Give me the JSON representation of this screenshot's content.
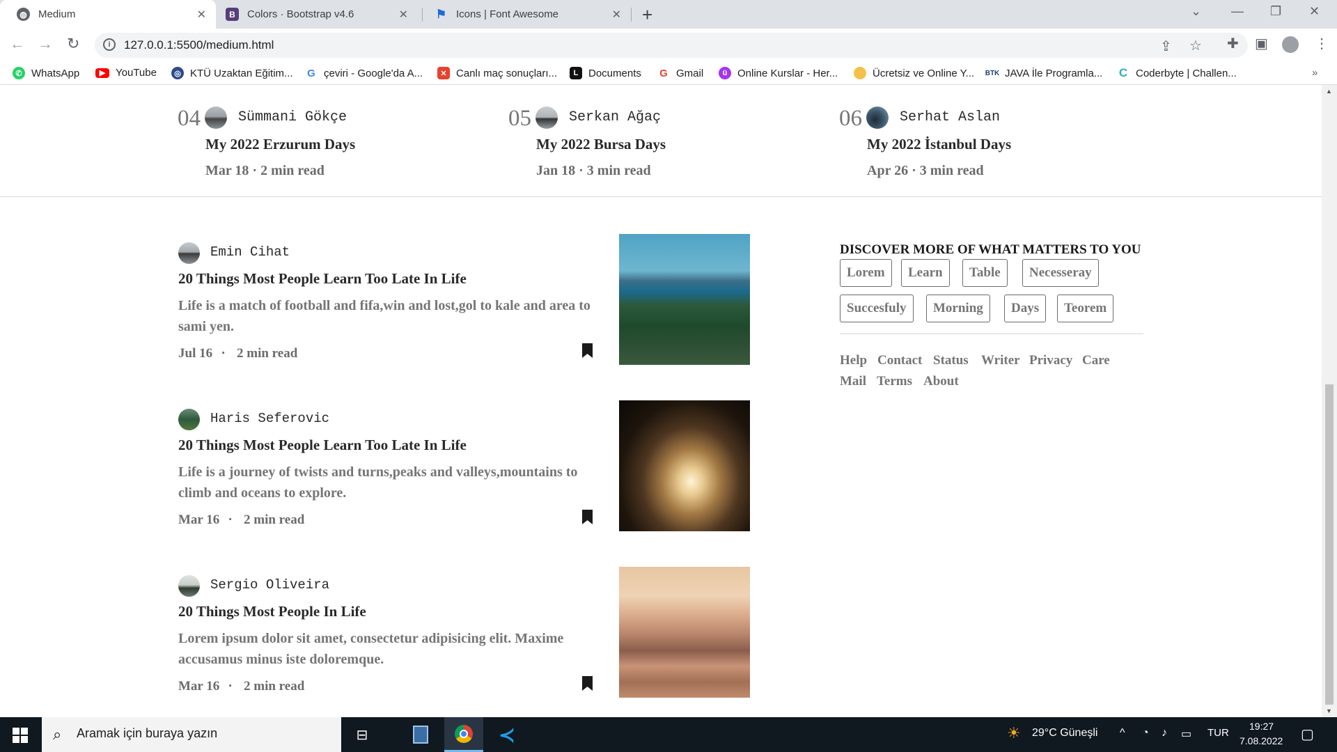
{
  "browser": {
    "tabs": [
      {
        "title": "Medium",
        "active": true
      },
      {
        "title": "Colors · Bootstrap v4.6",
        "active": false
      },
      {
        "title": "Icons | Font Awesome",
        "active": false
      }
    ],
    "url": "127.0.0.1:5500/medium.html",
    "bookmarks": [
      "WhatsApp",
      "YouTube",
      "KTÜ Uzaktan Eğitim...",
      "çeviri - Google'da A...",
      "Canlı maç sonuçları...",
      "Documents",
      "Gmail",
      "Online Kurslar - Her...",
      "Ücretsiz ve Online Y...",
      "JAVA İle Programla...",
      "Coderbyte | Challen..."
    ]
  },
  "trending": [
    {
      "num": "04",
      "author": "Sümmani Gökçe",
      "title": "My 2022 Erzurum Days",
      "meta": "Mar 18 · 2 min read"
    },
    {
      "num": "05",
      "author": "Serkan Ağaç",
      "title": "My 2022 Bursa Days",
      "meta": "Jan 18 · 3 min read"
    },
    {
      "num": "06",
      "author": "Serhat Aslan",
      "title": "My 2022 İstanbul Days",
      "meta": "Apr 26 · 3 min read"
    }
  ],
  "posts": [
    {
      "author": "Emin Cihat",
      "title": "20 Things Most People Learn Too Late In Life",
      "excerpt": "Life is a match of football and fifa,win and lost,gol to kale and area to sami yen.",
      "date": "Jul 16",
      "dot": "·",
      "read": "2 min read"
    },
    {
      "author": "Haris Seferovic",
      "title": "20 Things Most People Learn Too Late In Life",
      "excerpt": "Life is a journey of twists and turns,peaks and valleys,mountains to climb and oceans to explore.",
      "date": "Mar 16",
      "dot": "·",
      "read": "2 min read"
    },
    {
      "author": "Sergio Oliveira",
      "title": "20 Things Most People In Life",
      "excerpt": "Lorem ipsum dolor sit amet, consectetur adipisicing elit. Maxime accusamus minus iste doloremque.",
      "date": "Mar 16",
      "dot": "·",
      "read": "2 min read"
    }
  ],
  "discover": {
    "heading": "DISCOVER MORE OF WHAT MATTERS TO YOU",
    "topics": [
      "Lorem",
      "Learn",
      "Table",
      "Necesseray",
      "Succesfuly",
      "Morning",
      "Days",
      "Teorem"
    ],
    "footer_links": [
      "Help",
      "Contact",
      "Status",
      "Writer",
      "Privacy",
      "Care",
      "Mail",
      "Terms",
      "About"
    ]
  },
  "taskbar": {
    "search_placeholder": "Aramak için buraya yazın",
    "weather": "29°C Güneşli",
    "language": "TUR",
    "time": "19:27",
    "date": "7.08.2022"
  }
}
